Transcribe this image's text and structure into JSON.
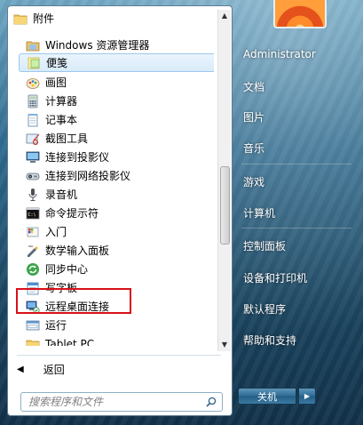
{
  "program_list": {
    "items": [
      {
        "label": "附件",
        "icon": "folder-icon"
      },
      {
        "label": "Windows 资源管理器",
        "icon": "explorer-icon"
      },
      {
        "label": "便笺",
        "icon": "sticky-notes-icon"
      },
      {
        "label": "画图",
        "icon": "paint-icon"
      },
      {
        "label": "计算器",
        "icon": "calculator-icon"
      },
      {
        "label": "记事本",
        "icon": "notepad-icon"
      },
      {
        "label": "截图工具",
        "icon": "snipping-tool-icon"
      },
      {
        "label": "连接到投影仪",
        "icon": "projector-icon"
      },
      {
        "label": "连接到网络投影仪",
        "icon": "network-projector-icon"
      },
      {
        "label": "录音机",
        "icon": "sound-recorder-icon"
      },
      {
        "label": "命令提示符",
        "icon": "command-prompt-icon"
      },
      {
        "label": "入门",
        "icon": "getting-started-icon"
      },
      {
        "label": "数学输入面板",
        "icon": "math-input-icon"
      },
      {
        "label": "同步中心",
        "icon": "sync-center-icon"
      },
      {
        "label": "写字板",
        "icon": "wordpad-icon"
      },
      {
        "label": "远程桌面连接",
        "icon": "remote-desktop-icon"
      },
      {
        "label": "运行",
        "icon": "run-icon"
      },
      {
        "label": "Tablet PC",
        "icon": "folder-icon"
      }
    ]
  },
  "back": {
    "label": "返回"
  },
  "search": {
    "placeholder": "搜索程序和文件"
  },
  "right_pane": {
    "items": [
      "Administrator",
      "文档",
      "图片",
      "音乐",
      "游戏",
      "计算机",
      "控制面板",
      "设备和打印机",
      "默认程序",
      "帮助和支持"
    ]
  },
  "shutdown": {
    "label": "关机"
  },
  "colors": {
    "highlight_border": "#d9101a",
    "selection_bg": "#dcedfb"
  }
}
